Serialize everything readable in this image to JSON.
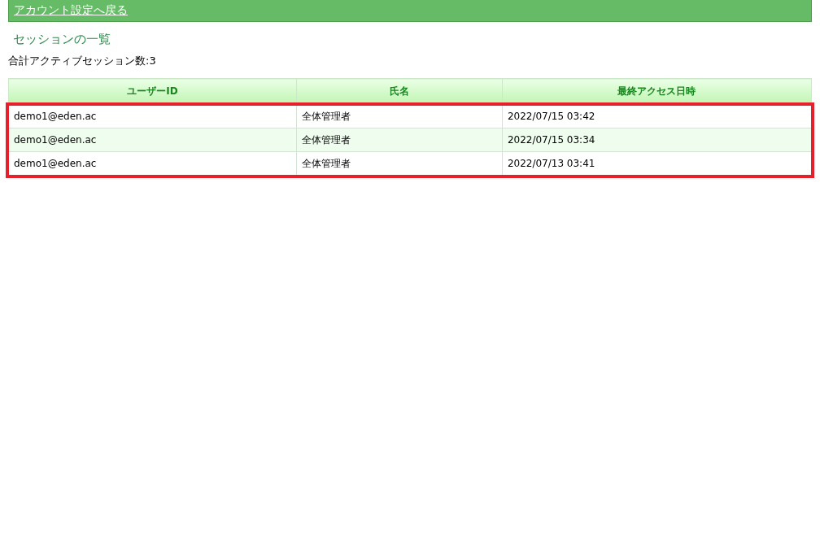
{
  "back_link": "アカウント設定へ戻る",
  "title": "セッションの一覧",
  "total": "合計アクティブセッション数:3",
  "table": {
    "columns": [
      "ユーザーID",
      "氏名",
      "最終アクセス日時"
    ],
    "rows": [
      [
        "demo1@eden.ac",
        "全体管理者",
        "2022/07/15 03:42"
      ],
      [
        "demo1@eden.ac",
        "全体管理者",
        "2022/07/15 03:34"
      ],
      [
        "demo1@eden.ac",
        "全体管理者",
        "2022/07/13 03:41"
      ]
    ]
  }
}
